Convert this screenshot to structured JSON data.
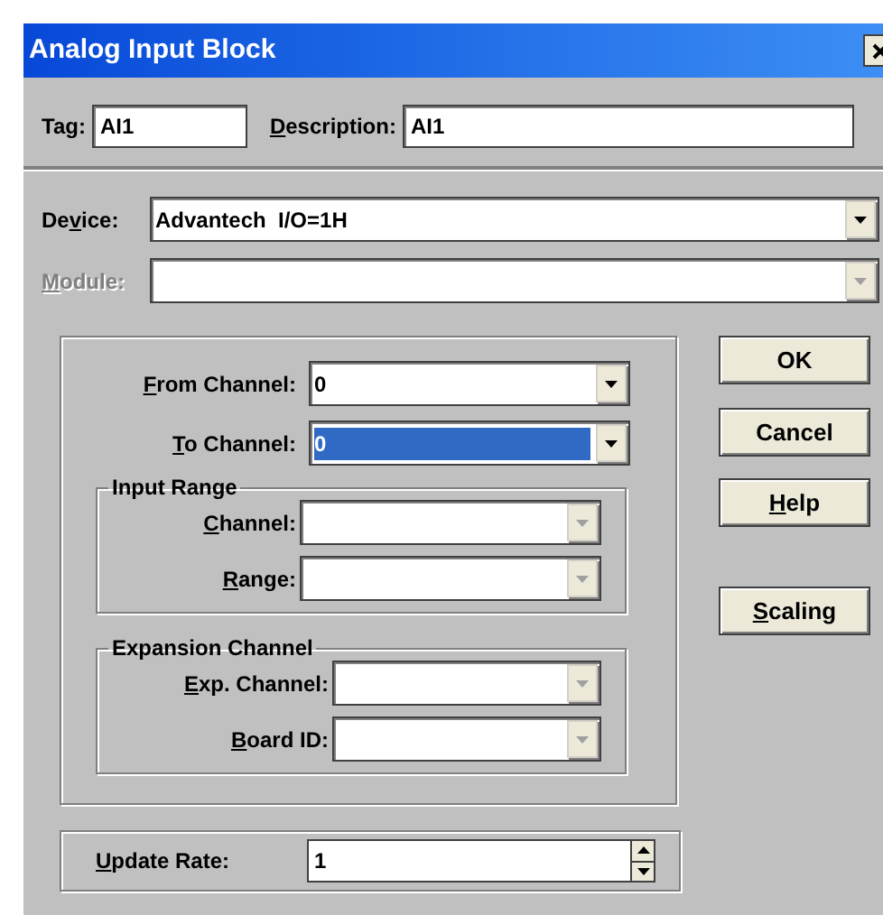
{
  "window": {
    "title": "Analog Input Block"
  },
  "tag": {
    "label": {
      "post": "Tag:"
    },
    "value": "AI1"
  },
  "description": {
    "label": {
      "key": "D",
      "post": "escription:"
    },
    "value": "AI1"
  },
  "device": {
    "label": {
      "pre": "De",
      "key": "v",
      "post": "ice:"
    },
    "label_disabled": false,
    "value": "Advantech  I/O=1H",
    "disabled": false
  },
  "module": {
    "label": {
      "key": "M",
      "post": "odule:"
    },
    "label_disabled": true,
    "disabled": true
  },
  "channels": [
    {
      "label": {
        "key": "F",
        "post": "rom Channel:"
      },
      "value": "0",
      "disabled": false,
      "highlighted": false
    },
    {
      "label": {
        "key": "T",
        "post": "o Channel:"
      },
      "value": "0",
      "disabled": false,
      "highlighted": true
    }
  ],
  "groups": [
    {
      "title": "Input Range",
      "fields": [
        {
          "label": {
            "key": "C",
            "post": "hannel:"
          },
          "disabled": true
        },
        {
          "label": {
            "key": "R",
            "post": "ange:"
          },
          "disabled": true
        }
      ]
    },
    {
      "title": "Expansion Channel",
      "fields": [
        {
          "label": {
            "key": "E",
            "post": "xp. Channel:"
          },
          "disabled": true
        },
        {
          "label": {
            "key": "B",
            "post": "oard ID:"
          },
          "disabled": true
        }
      ]
    }
  ],
  "update_rate": {
    "label": {
      "key": "U",
      "post": "pdate Rate:"
    },
    "value": "1"
  },
  "buttons": [
    {
      "label": {
        "post": "OK"
      }
    },
    {
      "label": {
        "post": "Cancel"
      }
    },
    {
      "label": {
        "key": "H",
        "post": "elp"
      }
    },
    {
      "label": {
        "key": "S",
        "post": "caling"
      }
    }
  ]
}
